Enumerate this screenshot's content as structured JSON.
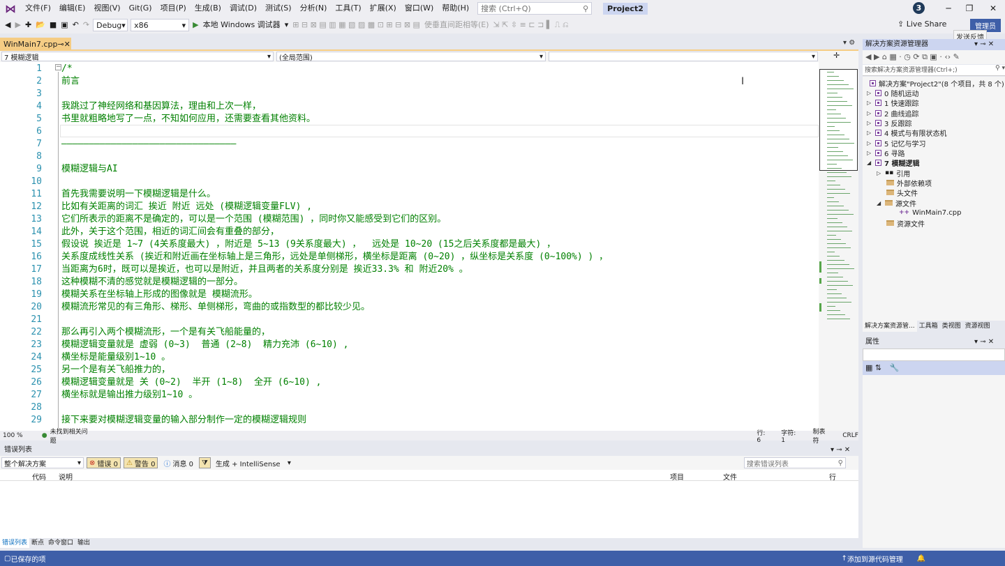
{
  "menu": {
    "items": [
      "文件(F)",
      "编辑(E)",
      "视图(V)",
      "Git(G)",
      "项目(P)",
      "生成(B)",
      "调试(D)",
      "测试(S)",
      "分析(N)",
      "工具(T)",
      "扩展(X)",
      "窗口(W)",
      "帮助(H)"
    ],
    "search_placeholder": "搜索 (Ctrl+Q)",
    "project": "Project2",
    "avatar_initial": "3"
  },
  "toolbar": {
    "config": "Debug",
    "platform": "x86",
    "run_label": "本地 Windows 调试器",
    "run_icon": "play-icon",
    "indent_label": "使垂直间距相等(E)",
    "live_share": "Live Share",
    "admin_badge": "管理员",
    "feedback_tooltip": "发送反馈"
  },
  "editor": {
    "tab_name": "WinMain7.cpp",
    "scope_combo": "7 模糊逻辑",
    "global_combo": "(全局范围)",
    "member_combo": "",
    "lines": [
      {
        "n": "1",
        "t": "/*"
      },
      {
        "n": "2",
        "t": "前言"
      },
      {
        "n": "3",
        "t": ""
      },
      {
        "n": "4",
        "t": "我跳过了神经网络和基因算法，理由和上次一样，"
      },
      {
        "n": "5",
        "t": "书里就粗略地写了一点，不知如何应用，还需要查看其他资料。"
      },
      {
        "n": "6",
        "t": ""
      },
      {
        "n": "7",
        "t": "————————————————————————————————"
      },
      {
        "n": "8",
        "t": ""
      },
      {
        "n": "9",
        "t": "模糊逻辑与AI"
      },
      {
        "n": "10",
        "t": ""
      },
      {
        "n": "11",
        "t": "首先我需要说明一下模糊逻辑是什么。"
      },
      {
        "n": "12",
        "t": "比如有关距离的词汇 挨近 附近 远处 (模糊逻辑变量FLV) ,"
      },
      {
        "n": "13",
        "t": "它们所表示的距离不是确定的，可以是一个范围 (模糊范围) ，同时你又能感受到它们的区别。"
      },
      {
        "n": "14",
        "t": "此外，关于这个范围，相近的词汇间会有重叠的部分，"
      },
      {
        "n": "15",
        "t": "假设说 挨近是 1~7 (4关系度最大) ，附近是 5~13 (9关系度最大) ，  远处是 10~20 (15之后关系度都是最大) ，"
      },
      {
        "n": "16",
        "t": "关系度成线性关系 (挨近和附近画在坐标轴上是三角形，远处是单侧梯形，横坐标是距离 (0~20) ，纵坐标是关系度 (0~100%) ) ，"
      },
      {
        "n": "17",
        "t": "当距离为6时，既可以是挨近，也可以是附近，并且两者的关系度分别是 挨近33.3% 和 附近20% 。"
      },
      {
        "n": "18",
        "t": "这种模糊不清的感觉就是模糊逻辑的一部分。"
      },
      {
        "n": "19",
        "t": "模糊关系在坐标轴上形成的图像就是 模糊流形。"
      },
      {
        "n": "20",
        "t": "模糊流形常见的有三角形、梯形、单侧梯形，弯曲的或指数型的都比较少见。"
      },
      {
        "n": "21",
        "t": ""
      },
      {
        "n": "22",
        "t": "那么再引入两个模糊流形，一个是有关飞船能量的，"
      },
      {
        "n": "23",
        "t": "模糊逻辑变量就是 虚弱 (0~3)  普通 (2~8)  精力充沛 (6~10) ,"
      },
      {
        "n": "24",
        "t": "横坐标是能量级别1~10 。"
      },
      {
        "n": "25",
        "t": "另一个是有关飞船推力的，"
      },
      {
        "n": "26",
        "t": "模糊逻辑变量就是 关 (0~2)  半开 (1~8)  全开 (6~10) ,"
      },
      {
        "n": "27",
        "t": "横坐标就是输出推力级别1~10 。"
      },
      {
        "n": "28",
        "t": ""
      },
      {
        "n": "29",
        "t": "接下来要对模糊逻辑变量的输入部分制作一定的模糊逻辑规则"
      }
    ],
    "zoom": "100 %",
    "issues": "未找到相关问题",
    "line_pos": "行: 6",
    "char_pos": "字符: 1",
    "tab_mode": "制表符",
    "eol": "CRLF"
  },
  "error_list": {
    "title": "错误列表",
    "scope": "整个解决方案",
    "errors": "错误 0",
    "warnings": "警告 0",
    "messages": "消息 0",
    "filter": "生成 + IntelliSense",
    "search_placeholder": "搜索错误列表",
    "columns": [
      "代码",
      "说明",
      "项目",
      "文件",
      "行"
    ]
  },
  "bottom_tabs": [
    "错误列表",
    "断点",
    "命令窗口",
    "输出"
  ],
  "status": {
    "left": "已保存的项",
    "right": "添加到源代码管理"
  },
  "solution_explorer": {
    "title": "解决方案资源管理器",
    "search_placeholder": "搜索解决方案资源管理器(Ctrl+;)",
    "solution_label": "解决方案\"Project2\"(8 个项目，共 8 个)",
    "projects": [
      "0 随机运动",
      "1 快速跟踪",
      "2 曲线追踪",
      "3 反跟踪",
      "4 模式与有限状态机",
      "5 记忆与学习",
      "6 寻路",
      "7 模糊逻辑"
    ],
    "children": [
      "引用",
      "外部依赖项",
      "头文件",
      "源文件",
      "WinMain7.cpp",
      "资源文件"
    ],
    "tabs": [
      "解决方案资源管...",
      "工具箱",
      "类视图",
      "资源视图"
    ]
  },
  "properties": {
    "title": "属性"
  }
}
